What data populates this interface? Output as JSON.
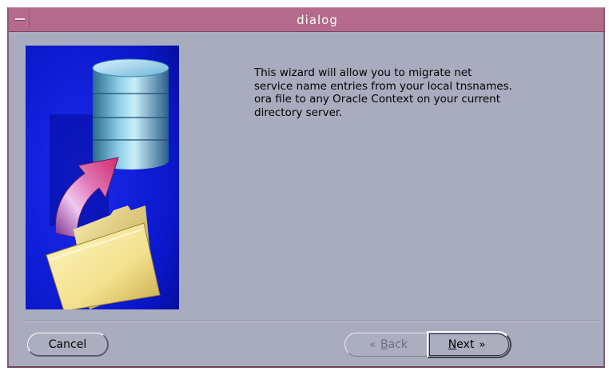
{
  "window": {
    "title": "dialog"
  },
  "description": {
    "lines": [
      "This wizard will allow you to migrate net",
      "service name entries from your local tnsnames.",
      "ora file to any Oracle Context on your current",
      "directory server."
    ]
  },
  "buttons": {
    "cancel": "Cancel",
    "back_mnemonic": "B",
    "back_rest": "ack",
    "back_icon": "«",
    "next_mnemonic": "N",
    "next_rest": "ext",
    "next_icon": "»",
    "back_enabled": false,
    "next_default": true
  },
  "illustration": {
    "subjects": [
      "database-cylinder-icon",
      "upload-arrow-icon",
      "folder-icon"
    ],
    "background_color": "#0b1ad6"
  },
  "colors": {
    "titlebar": "#b46a8a",
    "dialog_background": "#a9acbe"
  }
}
